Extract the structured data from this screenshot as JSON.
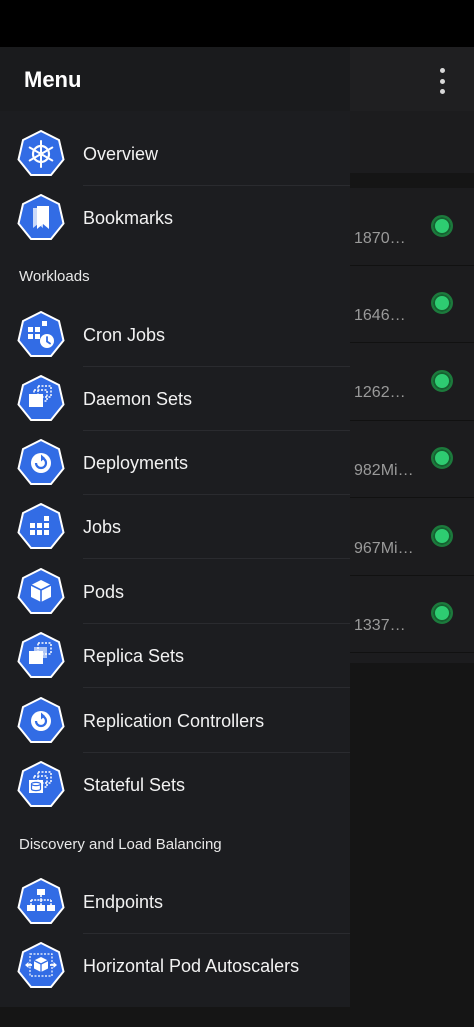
{
  "drawer": {
    "title": "Menu",
    "top_items": [
      {
        "label": "Overview",
        "icon": "helm-wheel-icon"
      },
      {
        "label": "Bookmarks",
        "icon": "bookmarks-icon"
      }
    ],
    "sections": [
      {
        "title": "Workloads",
        "items": [
          {
            "label": "Cron Jobs",
            "icon": "cron-jobs-icon"
          },
          {
            "label": "Daemon Sets",
            "icon": "daemon-sets-icon"
          },
          {
            "label": "Deployments",
            "icon": "deployments-icon"
          },
          {
            "label": "Jobs",
            "icon": "jobs-icon"
          },
          {
            "label": "Pods",
            "icon": "pods-icon"
          },
          {
            "label": "Replica Sets",
            "icon": "replica-sets-icon"
          },
          {
            "label": "Replication Controllers",
            "icon": "replication-controllers-icon"
          },
          {
            "label": "Stateful Sets",
            "icon": "stateful-sets-icon"
          }
        ]
      },
      {
        "title": "Discovery and Load Balancing",
        "items": [
          {
            "label": "Endpoints",
            "icon": "endpoints-icon"
          },
          {
            "label": "Horizontal Pod Autoscalers",
            "icon": "hpa-icon"
          }
        ]
      }
    ]
  },
  "background": {
    "rows": [
      {
        "value": "1870…",
        "status": "green"
      },
      {
        "value": "1646…",
        "status": "green"
      },
      {
        "value": "1262…",
        "status": "green"
      },
      {
        "value": "982Mi…",
        "status": "green"
      },
      {
        "value": "967Mi…",
        "status": "green"
      },
      {
        "value": "1337…",
        "status": "green"
      }
    ]
  },
  "colors": {
    "accent": "#326ce5",
    "status_green": "#2ecc71"
  }
}
